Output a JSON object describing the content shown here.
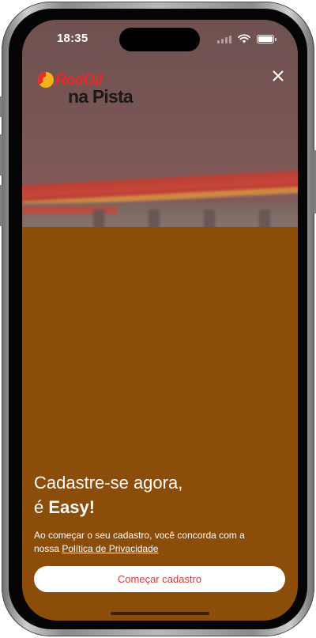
{
  "status_bar": {
    "time": "18:35",
    "icons": [
      "signal-icon",
      "wifi-icon",
      "battery-icon"
    ]
  },
  "brand": {
    "name_top": "RodOil",
    "name_bottom": "na Pista",
    "logo_icon": "rodoil-logo-icon",
    "accent_red": "#ea2a2a",
    "accent_yellow": "#f3b21b"
  },
  "header": {
    "close_icon": "close-icon"
  },
  "hero": {
    "image": "gas-station-photo"
  },
  "content": {
    "headline_line1": "Cadastre-se agora,",
    "headline_prefix": "é ",
    "headline_bold": "Easy!",
    "terms_text": "Ao começar o seu cadastro, você concorda com a nossa ",
    "privacy_link": "Política de Privacidade"
  },
  "cta": {
    "label": "Começar cadastro"
  },
  "colors": {
    "background": "#8c4d0a",
    "hero_tint": "#7a5656",
    "button_bg": "#ffffff",
    "button_text": "#d23b3b"
  }
}
